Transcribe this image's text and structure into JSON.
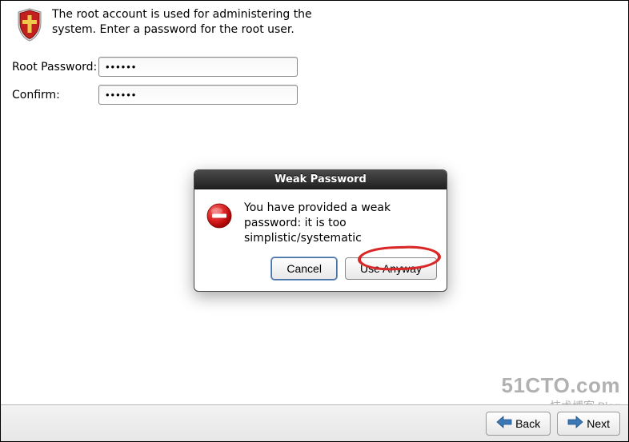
{
  "header": {
    "description": "The root account is used for administering the system.  Enter a password for the root user."
  },
  "form": {
    "root_password_label": "Root Password:",
    "root_password_value": "••••••",
    "confirm_label": "Confirm:",
    "confirm_value": "••••••"
  },
  "dialog": {
    "title": "Weak Password",
    "message": "You have provided a weak password: it is too simplistic/systematic",
    "cancel_label": "Cancel",
    "use_anyway_label": "Use Anyway"
  },
  "footer": {
    "back_label": "Back",
    "next_label": "Next"
  },
  "watermark": {
    "line1": "51CTO.com",
    "line2": "技术博客 Blog"
  }
}
